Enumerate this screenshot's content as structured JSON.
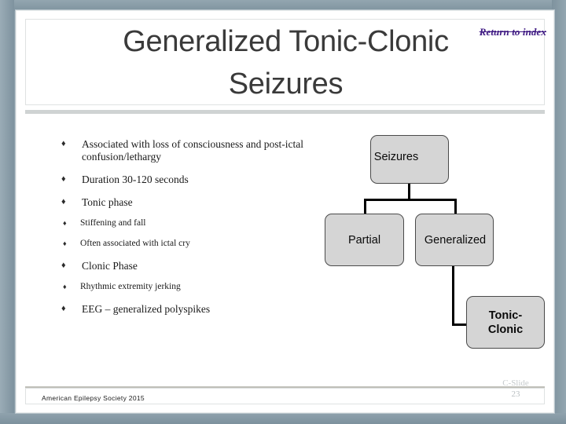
{
  "slide": {
    "title": "Generalized Tonic-Clonic\nSeizures",
    "return_link": "Return to index",
    "return_link_color": "#3f1a83"
  },
  "bullets": [
    {
      "level": 1,
      "marker": "bullet-diamond",
      "text": "Associated with loss of consciousness and post-ictal confusion/lethargy",
      "children": []
    },
    {
      "level": 1,
      "marker": "bullet-diamond",
      "text": "Duration 30-120 seconds",
      "children": []
    },
    {
      "level": 1,
      "marker": "bullet-diamond",
      "text": "Tonic phase",
      "children": [
        {
          "level": 2,
          "marker": "bullet-diamond-small",
          "text": "Stiffening and fall"
        },
        {
          "level": 2,
          "marker": "bullet-diamond-small",
          "text": "Often associated with ictal cry"
        }
      ]
    },
    {
      "level": 1,
      "marker": "bullet-diamond",
      "text": "Clonic Phase",
      "children": [
        {
          "level": 2,
          "marker": "bullet-diamond-small",
          "text": "Rhythmic extremity jerking"
        }
      ]
    },
    {
      "level": 1,
      "marker": "bullet-diamond",
      "text": "EEG – generalized polyspikes",
      "children": []
    }
  ],
  "diagram": {
    "fill_color": "#d5d5d5",
    "border_color": "#4a4a4a",
    "edge_color": "#000000",
    "nodes": [
      {
        "id": "seizures",
        "label": "Seizures"
      },
      {
        "id": "partial",
        "label": "Partial"
      },
      {
        "id": "generalized",
        "label": "Generalized"
      },
      {
        "id": "tonic-clonic",
        "label": "Tonic-\nClonic"
      }
    ]
  },
  "footer": {
    "credit": "American Epilepsy Society 2015",
    "slide_tag": "C-Slide",
    "slide_number": "23"
  },
  "icons": {
    "bullet_level1": "♦",
    "bullet_level2": "♦"
  }
}
